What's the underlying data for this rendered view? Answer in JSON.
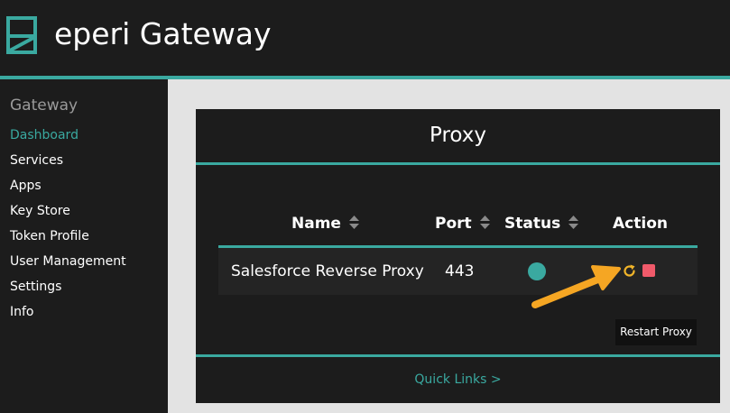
{
  "app": {
    "title": "eperi Gateway"
  },
  "sidebar": {
    "heading": "Gateway",
    "items": [
      {
        "label": "Dashboard",
        "active": true
      },
      {
        "label": "Services"
      },
      {
        "label": "Apps"
      },
      {
        "label": "Key Store"
      },
      {
        "label": "Token Profile"
      },
      {
        "label": "User Management"
      },
      {
        "label": "Settings"
      },
      {
        "label": "Info"
      }
    ]
  },
  "panel": {
    "title": "Proxy",
    "columns": [
      "Name",
      "Port",
      "Status",
      "Action"
    ],
    "rows": [
      {
        "name": "Salesforce Reverse Proxy",
        "port": "443",
        "status": "running"
      }
    ],
    "tooltip": "Restart Proxy",
    "quick_links": "Quick Links >"
  },
  "colors": {
    "accent": "#3aa9a0",
    "stop": "#f05a6a",
    "restart": "#f0b429",
    "annotation_arrow": "#f5a623",
    "background": "#1c1c1c",
    "content_background": "#e3e3e3"
  },
  "icons": {
    "logo": "eperi-logo-icon",
    "sort": "sort-icon",
    "restart": "restart-icon",
    "stop": "stop-icon"
  }
}
